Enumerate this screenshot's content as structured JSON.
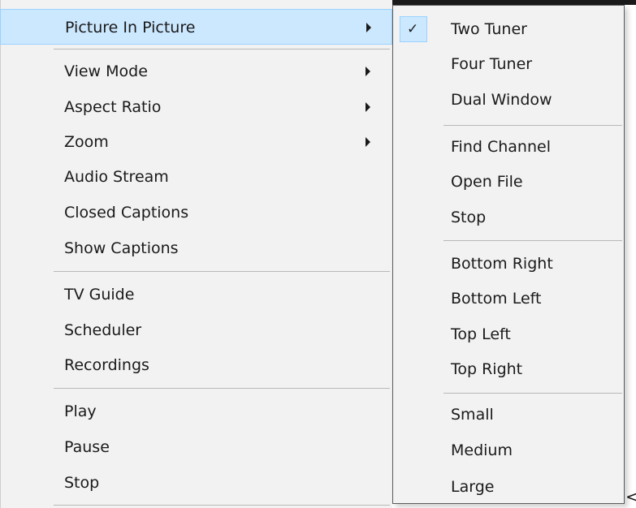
{
  "main_menu": {
    "items": [
      {
        "label": "Picture In Picture",
        "submenu": true,
        "highlighted": true
      },
      {
        "label": "View Mode",
        "submenu": true
      },
      {
        "label": "Aspect Ratio",
        "submenu": true
      },
      {
        "label": "Zoom",
        "submenu": true
      },
      {
        "label": "Audio Stream",
        "submenu": false
      },
      {
        "label": "Closed Captions",
        "submenu": false
      },
      {
        "label": "Show Captions",
        "submenu": false
      },
      {
        "label": "TV Guide",
        "submenu": false
      },
      {
        "label": "Scheduler",
        "submenu": false
      },
      {
        "label": "Recordings",
        "submenu": false
      },
      {
        "label": "Play",
        "submenu": false
      },
      {
        "label": "Pause",
        "submenu": false
      },
      {
        "label": "Stop",
        "submenu": false
      }
    ]
  },
  "pip_submenu": {
    "items": [
      {
        "label": "Two Tuner",
        "checked": true
      },
      {
        "label": "Four Tuner"
      },
      {
        "label": "Dual Window"
      },
      {
        "label": "Find Channel"
      },
      {
        "label": "Open File"
      },
      {
        "label": "Stop"
      },
      {
        "label": "Bottom Right"
      },
      {
        "label": "Bottom Left"
      },
      {
        "label": "Top Left"
      },
      {
        "label": "Top Right"
      },
      {
        "label": "Small"
      },
      {
        "label": "Medium"
      },
      {
        "label": "Large"
      }
    ],
    "check_glyph": "✓"
  },
  "stray_glyph": "<",
  "colors": {
    "menu_bg": "#f2f2f2",
    "highlight_bg": "#cce8ff",
    "highlight_border": "#99d1ff",
    "separator": "#b8b8b8"
  },
  "icons": {
    "submenu_arrow": "submenu-arrow-icon",
    "check": "check-icon"
  }
}
